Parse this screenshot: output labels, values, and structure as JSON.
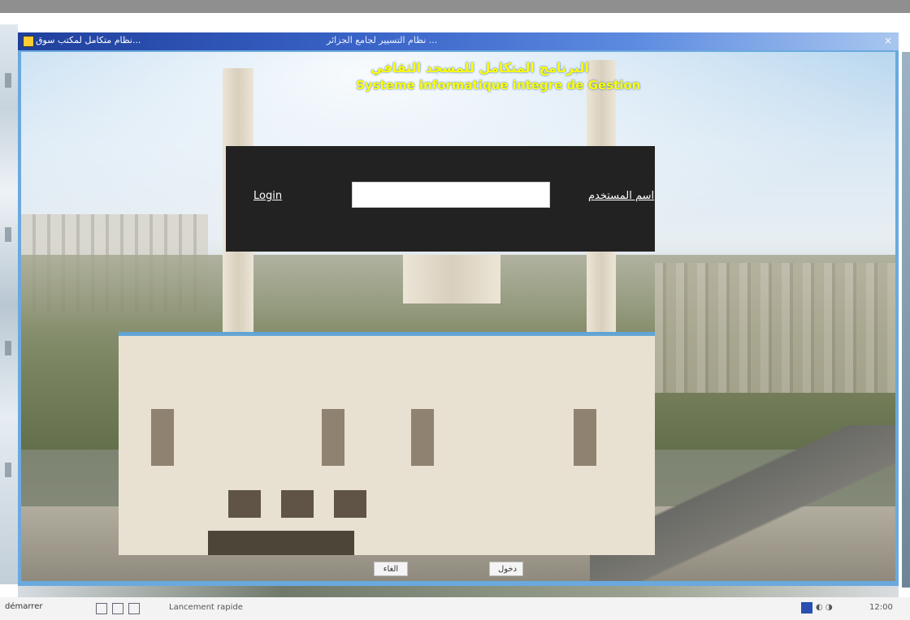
{
  "window": {
    "left_title": "نظام متكامل لمكتب سوق...",
    "center_title": "نظام التسيير لجامع الجزائر ...",
    "close_glyph": "×"
  },
  "heading": {
    "arabic": "البرنامج المتكامل للمسجد الثقافي",
    "latin": "Systeme informatique integre de Gestion"
  },
  "login": {
    "left_label": "Login",
    "input_value": "",
    "right_label": "اسم المستخدم"
  },
  "buttons": {
    "left": "الغاء",
    "right": "دخول"
  },
  "taskbar": {
    "start_label": "démarrer",
    "program_label": "Lancement rapide",
    "tray_text": "12:00"
  },
  "colors": {
    "heading": "#ffff00",
    "panel": "#222222",
    "titlebar_start": "#1f3f9c"
  }
}
